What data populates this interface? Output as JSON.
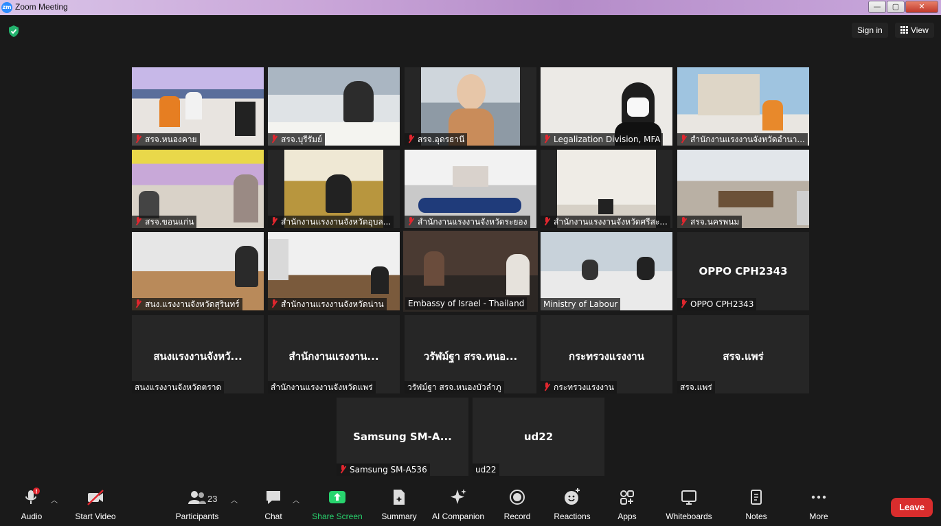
{
  "window": {
    "title": "Zoom Meeting",
    "logo_text": "zm",
    "min": "—",
    "max": "▢",
    "close": "✕"
  },
  "topbar": {
    "sign_in": "Sign in",
    "view": "View"
  },
  "tiles": [
    {
      "name": "สรจ.หนองคาย",
      "muted": true
    },
    {
      "name": "สรจ.บุรีรัมย์",
      "muted": true
    },
    {
      "name": "สรจ.อุดรธานี",
      "muted": true
    },
    {
      "name": "Legalization Division, MFA",
      "muted": true
    },
    {
      "name": "สำนักงานแรงงานจังหวัดอำนา...",
      "muted": true
    },
    {
      "name": "สรจ.ขอนแก่น",
      "muted": true
    },
    {
      "name": "สำนักงานแรงงานจังหวัดอุบล...",
      "muted": true
    },
    {
      "name": "สำนักงานแรงงานจังหวัดระยอง",
      "muted": true
    },
    {
      "name": "สำนักงานแรงงานจังหวัดศรีสะ...",
      "muted": true
    },
    {
      "name": "สรจ.นครพนม",
      "muted": true
    },
    {
      "name": "สนง.แรงงานจังหวัดสุรินทร์",
      "muted": true
    },
    {
      "name": "สำนักงานแรงงานจังหวัดน่าน",
      "muted": true
    },
    {
      "name": "Embassy of Israel - Thailand",
      "muted": false,
      "active": true
    },
    {
      "name": "Ministry of Labour",
      "muted": false
    },
    {
      "name": "OPPO CPH2343",
      "display": "OPPO CPH2343",
      "muted": true
    },
    {
      "name": "สนงแรงงานจังหวัดตราด",
      "display": "สนงแรงงานจังหวั...",
      "muted": false
    },
    {
      "name": "สำนักงานแรงงานจังหวัดแพร่",
      "display": "สำนักงานแรงงาน...",
      "muted": false
    },
    {
      "name": "วรัฬม์ฐา สรจ.หนองบัวลำภู",
      "display": "วรัฬม์ฐา สรจ.หนอ...",
      "muted": false
    },
    {
      "name": "กระทรวงแรงงาน",
      "display": "กระทรวงแรงงาน",
      "muted": true
    },
    {
      "name": "สรจ.แพร่",
      "display": "สรจ.แพร่",
      "muted": false
    },
    {
      "name": "Samsung SM-A536",
      "display": "Samsung  SM-A...",
      "muted": true
    },
    {
      "name": "ud22",
      "display": "ud22",
      "muted": false
    }
  ],
  "toolbar": {
    "audio": "Audio",
    "start_video": "Start Video",
    "participants": "Participants",
    "participant_count": "23",
    "chat": "Chat",
    "share_screen": "Share Screen",
    "summary": "Summary",
    "ai_companion": "AI Companion",
    "record": "Record",
    "reactions": "Reactions",
    "apps": "Apps",
    "whiteboards": "Whiteboards",
    "notes": "Notes",
    "more": "More",
    "leave": "Leave",
    "audio_alert": "!"
  },
  "colors": {
    "accent_green": "#28d46e",
    "leave_red": "#d92d2d",
    "active_speaker": "#c8d642",
    "mute_red": "#e0262e"
  }
}
